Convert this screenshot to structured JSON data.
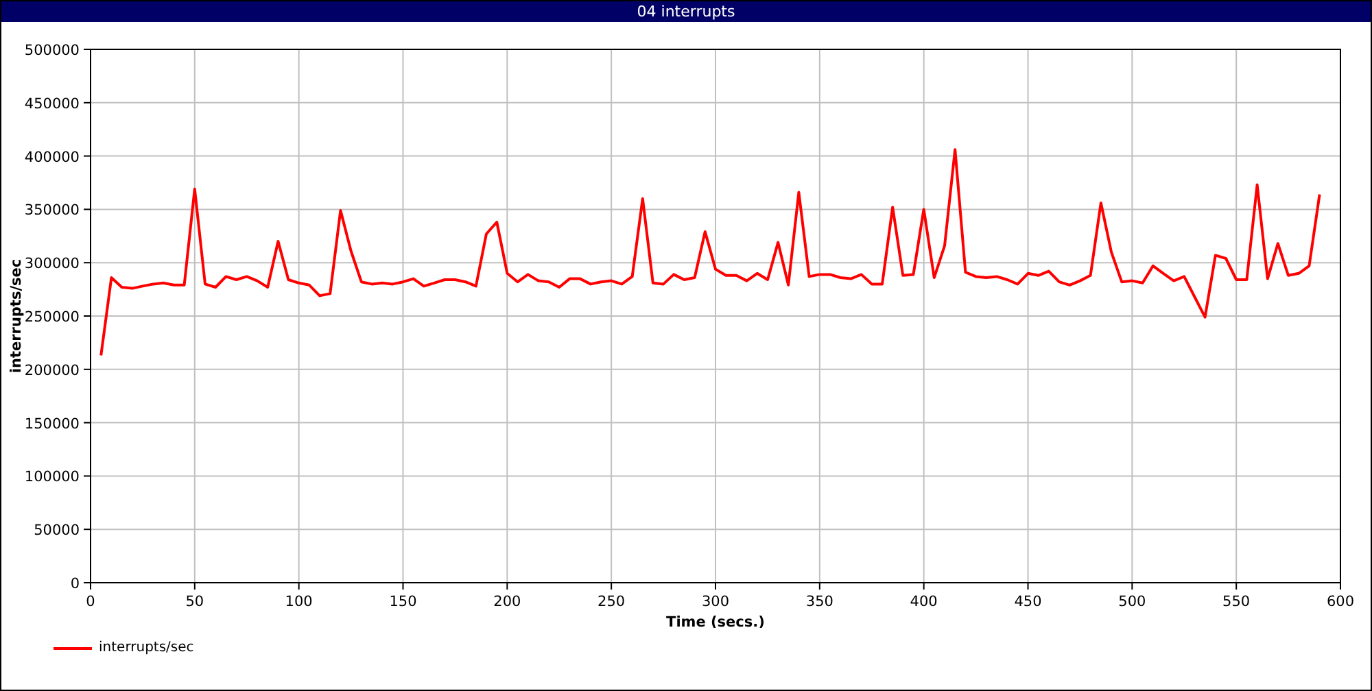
{
  "window": {
    "title": "04 interrupts"
  },
  "chart": {
    "chart_data": {
      "type": "line",
      "xlabel": "Time (secs.)",
      "ylabel": "interrupts/sec",
      "grid": true,
      "xlim": [
        0,
        600
      ],
      "ylim": [
        0,
        500000
      ],
      "xticks": [
        0,
        50,
        100,
        150,
        200,
        250,
        300,
        350,
        400,
        450,
        500,
        550,
        600
      ],
      "yticks": [
        0,
        50000,
        100000,
        150000,
        200000,
        250000,
        300000,
        350000,
        400000,
        450000,
        500000
      ],
      "x": [
        5,
        10,
        15,
        20,
        25,
        30,
        35,
        40,
        45,
        50,
        55,
        60,
        65,
        70,
        75,
        80,
        85,
        90,
        95,
        100,
        105,
        110,
        115,
        120,
        125,
        130,
        135,
        140,
        145,
        150,
        155,
        160,
        165,
        170,
        175,
        180,
        185,
        190,
        195,
        200,
        205,
        210,
        215,
        220,
        225,
        230,
        235,
        240,
        245,
        250,
        255,
        260,
        265,
        270,
        275,
        280,
        285,
        290,
        295,
        300,
        305,
        310,
        315,
        320,
        325,
        330,
        335,
        340,
        345,
        350,
        355,
        360,
        365,
        370,
        375,
        380,
        385,
        390,
        395,
        400,
        405,
        410,
        415,
        420,
        425,
        430,
        435,
        440,
        445,
        450,
        455,
        460,
        465,
        470,
        475,
        480,
        485,
        490,
        495,
        500,
        505,
        510,
        515,
        520,
        525,
        530,
        535,
        540,
        545,
        550,
        555,
        560,
        565,
        570,
        575,
        580,
        585,
        590
      ],
      "series": [
        {
          "name": "interrupts/sec",
          "color": "#ff0000",
          "values": [
            213000,
            286000,
            277000,
            276000,
            278000,
            280000,
            281000,
            279000,
            279000,
            369000,
            280000,
            277000,
            287000,
            284000,
            287000,
            283000,
            277000,
            320000,
            284000,
            281000,
            279000,
            269000,
            271000,
            349000,
            311000,
            282000,
            280000,
            281000,
            280000,
            282000,
            285000,
            278000,
            281000,
            284000,
            284000,
            282000,
            278000,
            327000,
            338000,
            290000,
            282000,
            289000,
            283000,
            282000,
            277000,
            285000,
            285000,
            280000,
            282000,
            283000,
            280000,
            287000,
            360000,
            281000,
            280000,
            289000,
            284000,
            286000,
            329000,
            294000,
            288000,
            288000,
            283000,
            290000,
            284000,
            319000,
            279000,
            366000,
            287000,
            289000,
            289000,
            286000,
            285000,
            289000,
            280000,
            280000,
            352000,
            288000,
            289000,
            350000,
            286000,
            316000,
            406000,
            291000,
            287000,
            286000,
            287000,
            284000,
            280000,
            290000,
            288000,
            292000,
            282000,
            279000,
            283000,
            288000,
            356000,
            310000,
            282000,
            283000,
            281000,
            297000,
            290000,
            283000,
            287000,
            268000,
            249000,
            307000,
            304000,
            284000,
            284000,
            373000,
            285000,
            318000,
            288000,
            290000,
            297000,
            364000
          ]
        }
      ]
    }
  }
}
